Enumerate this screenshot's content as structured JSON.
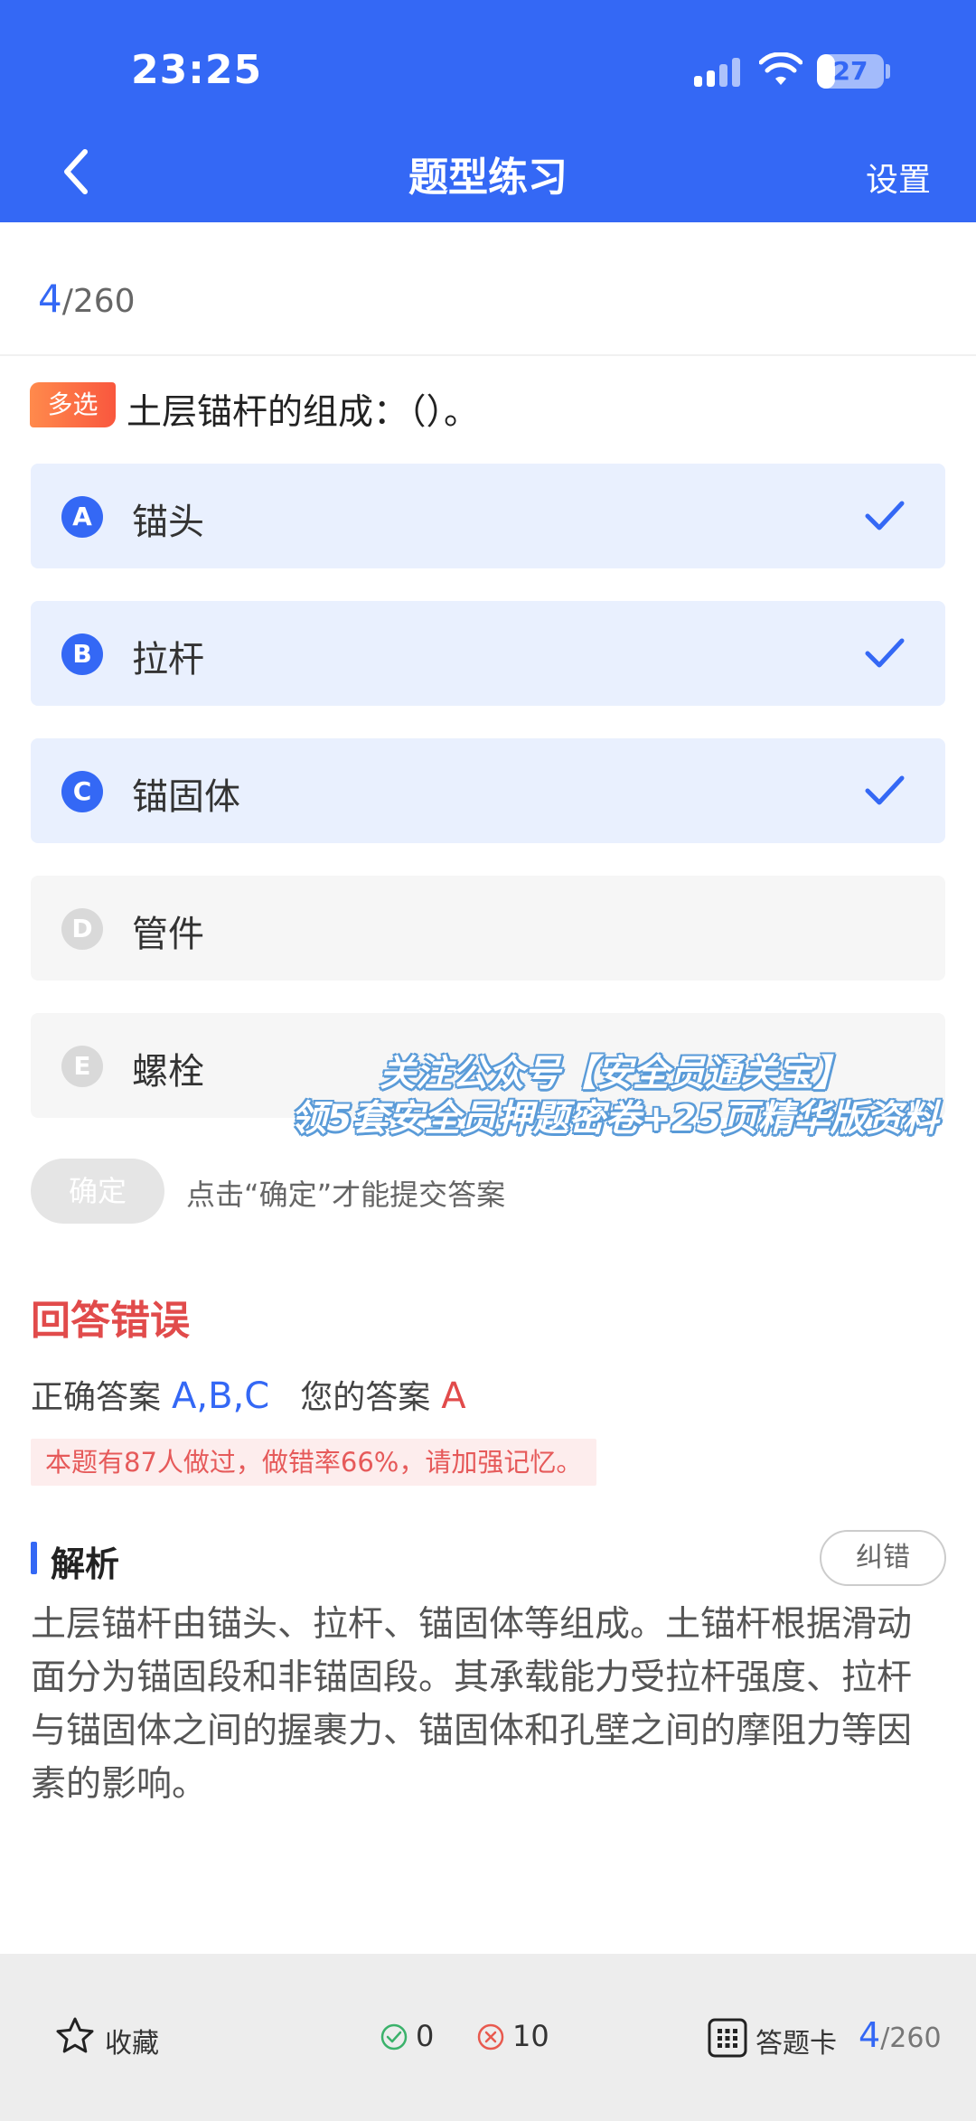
{
  "status_bar": {
    "time": "23:25",
    "battery": "27",
    "battery_level": 0.27
  },
  "nav": {
    "title": "题型练习",
    "settings_label": "设置"
  },
  "progress": {
    "current": "4",
    "total": "/260"
  },
  "question": {
    "type_label": "多选",
    "text": "土层锚杆的组成：（）。",
    "options": [
      {
        "letter": "A",
        "text": "锚头",
        "selected": true
      },
      {
        "letter": "B",
        "text": "拉杆",
        "selected": true
      },
      {
        "letter": "C",
        "text": "锚固体",
        "selected": true
      },
      {
        "letter": "D",
        "text": "管件",
        "selected": false
      },
      {
        "letter": "E",
        "text": "螺栓",
        "selected": false
      }
    ]
  },
  "watermark": {
    "line1": "关注公众号【安全员通关宝】",
    "line2": "领5套安全员押题密卷+25页精华版资料"
  },
  "submit": {
    "confirm_label": "确定",
    "hint": "点击“确定”才能提交答案"
  },
  "result": {
    "title": "回答错误",
    "correct_label": "正确答案",
    "correct_value": "A,B,C",
    "your_label": "您的答案",
    "your_value": "A",
    "stat_note": "本题有87人做过，做错率66%，请加强记忆。"
  },
  "analysis": {
    "title": "解析",
    "report_label": "纠错",
    "body": "土层锚杆由锚头、拉杆、锚固体等组成。土锚杆根据滑动面分为锚固段和非锚固段。其承载能力受拉杆强度、拉杆与锚固体之间的握裹力、锚固体和孔壁之间的摩阻力等因素的影响。"
  },
  "bottom_bar": {
    "favorite_label": "收藏",
    "right_count": "0",
    "wrong_count": "10",
    "answer_card_label": "答题卡",
    "progress_current": "4",
    "progress_total": "/260"
  },
  "colors": {
    "primary": "#3468F5",
    "error": "#E14B4B",
    "badge": "#F9573E"
  }
}
